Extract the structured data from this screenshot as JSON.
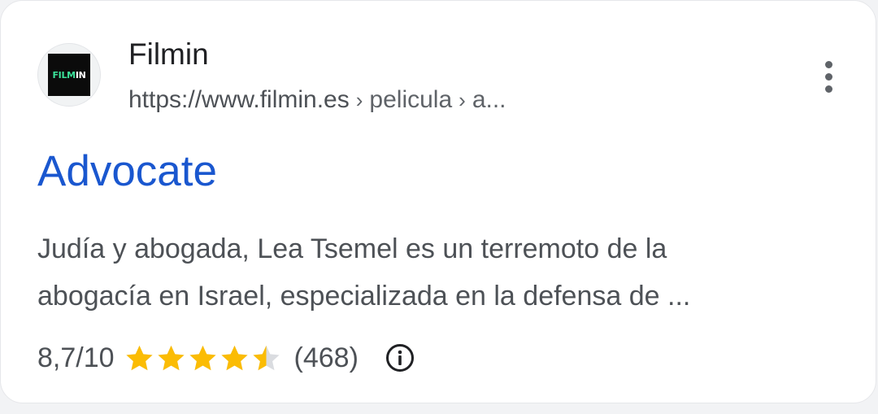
{
  "result": {
    "site_name": "Filmin",
    "favicon_text_left": "FILM",
    "favicon_text_right": "IN",
    "url_base": "https://www.filmin.es",
    "url_crumb_1": "pelicula",
    "url_crumb_2": "a...",
    "url_separator": "›",
    "title": "Advocate",
    "snippet_line_1": "Judía y abogada, Lea Tsemel es un terremoto de la",
    "snippet_line_2": "abogacía en Israel, especializada en la defensa de ...",
    "rating_text": "8,7/10",
    "rating_value": 8.7,
    "rating_max": 10,
    "stars_filled": 4.5,
    "stars_total": 5,
    "review_count": "(468)",
    "icons": {
      "menu": "more-vert-icon",
      "info": "info-icon",
      "star": "star-icon"
    }
  },
  "colors": {
    "title": "#1a57cf",
    "star_filled": "#fbbc04",
    "star_empty": "#dadce0",
    "text_secondary": "#4d5156"
  }
}
